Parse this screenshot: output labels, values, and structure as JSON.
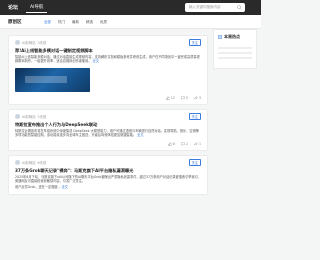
{
  "header": {
    "logo": "论坛",
    "nav": [
      "AI导航"
    ],
    "search_placeholder": "输入关键词搜索内容"
  },
  "subheader": {
    "title": "原创区",
    "chips": [
      "全部",
      "热门",
      "最新",
      "精选",
      "优质"
    ],
    "sidebar_title": "本周热点"
  },
  "cards": [
    {
      "author": "AI前哨站",
      "time": "3天前",
      "title": "荐!Ai上线智能多模对话一键制定视频脚本",
      "excerpt": "智能AI上线智能多模对话，通过对话直接生成视频内容，支持解析文档和模板参考并修改生成，用户在不同场景中一键完成高质量视频脚本制作，一键提升效率，适合自媒体创作者使用。",
      "more": "全文",
      "thumb": true,
      "likes": "12",
      "comments": "5",
      "shares": "3",
      "follow": "关注"
    },
    {
      "author": "AI前哨站",
      "time": "5天前",
      "title": "特斯拉宣布推出个人行为与DeepSeek联动",
      "excerpt": "特斯拉近期宣布将在车载系统中深度集成 DeepSeek 大模型能力，用户可通过语音与车辆进行自然对话，实现导航、音乐、空调等多项功能的智能控制，该功能将逐步向全球车主推送，升级后驾驶体验更加便捷智能。",
      "more": "全文",
      "thumb": false,
      "likes": "8",
      "comments": "2",
      "shares": "1",
      "follow": "关注"
    },
    {
      "author": "AI前哨站",
      "time": "6天前",
      "title": "37万条Grok聊天记录\"裸奔\"：马斯克旗下AI平台隐私漏洞曝光",
      "excerpt": "2025年8月下旬，马斯克旗下xAI公司旗下的AI聊天平台Grok被曝出严重隐私泄露事件，超过37万条用户对话记录被搜索引擎索引，普通网友可直接检索到敏感内容，引发广泛关注。",
      "extra": "用户反馈Grok，还在一定程度...",
      "more": "全文",
      "thumb": false,
      "likes": "15",
      "comments": "7",
      "shares": "4",
      "follow": "关注"
    }
  ]
}
